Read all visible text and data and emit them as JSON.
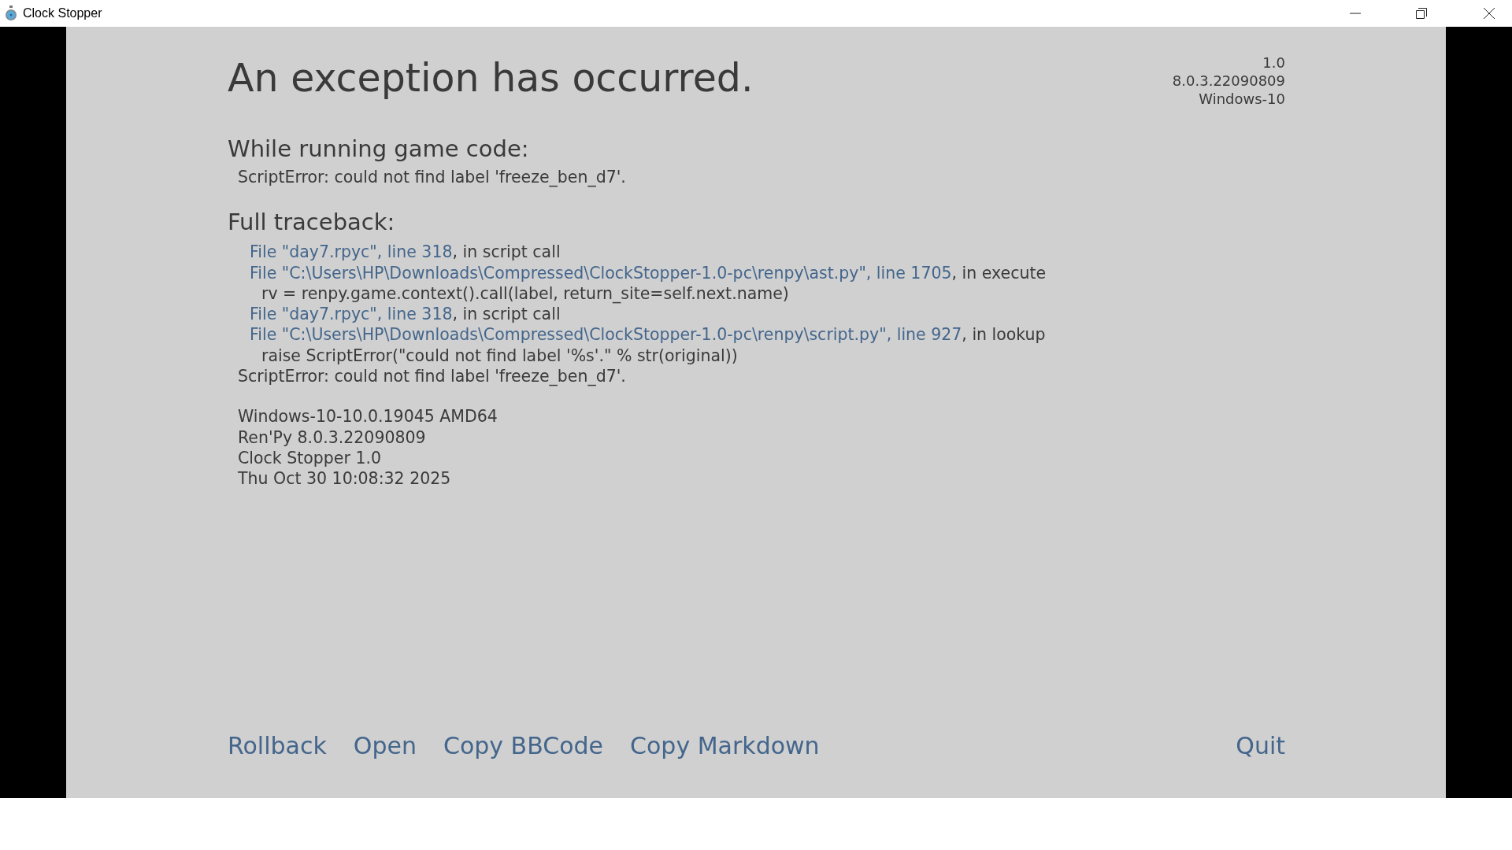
{
  "window": {
    "title": "Clock Stopper"
  },
  "heading": "An exception has occurred.",
  "version_lines": [
    "1.0",
    "8.0.3.22090809",
    "Windows-10"
  ],
  "game_code": {
    "heading": "While running game code:",
    "message": "ScriptError: could not find label 'freeze_ben_d7'."
  },
  "traceback": {
    "heading": "Full traceback:",
    "lines": [
      {
        "kind": "frame",
        "link": "File \"day7.rpyc\", line 318",
        "text": ", in script call"
      },
      {
        "kind": "frame",
        "link": "File \"C:\\Users\\HP\\Downloads\\Compressed\\ClockStopper-1.0-pc\\renpy\\ast.py\", line 1705",
        "text": ", in execute"
      },
      {
        "kind": "code",
        "text": "rv = renpy.game.context().call(label, return_site=self.next.name)"
      },
      {
        "kind": "frame",
        "link": "File \"day7.rpyc\", line 318",
        "text": ", in script call"
      },
      {
        "kind": "frame",
        "link": "File \"C:\\Users\\HP\\Downloads\\Compressed\\ClockStopper-1.0-pc\\renpy\\script.py\", line 927",
        "text": ", in lookup"
      },
      {
        "kind": "code",
        "text": "raise ScriptError(\"could not find label '%s'.\" % str(original))"
      },
      {
        "kind": "error",
        "text": "ScriptError: could not find label 'freeze_ben_d7'."
      }
    ]
  },
  "system_info": [
    "Windows-10-10.0.19045 AMD64",
    "Ren'Py 8.0.3.22090809",
    "Clock Stopper 1.0",
    "Thu Oct 30 10:08:32 2025"
  ],
  "actions_left": [
    "Rollback",
    "Open",
    "Copy BBCode",
    "Copy Markdown"
  ],
  "actions_right": [
    "Quit"
  ]
}
